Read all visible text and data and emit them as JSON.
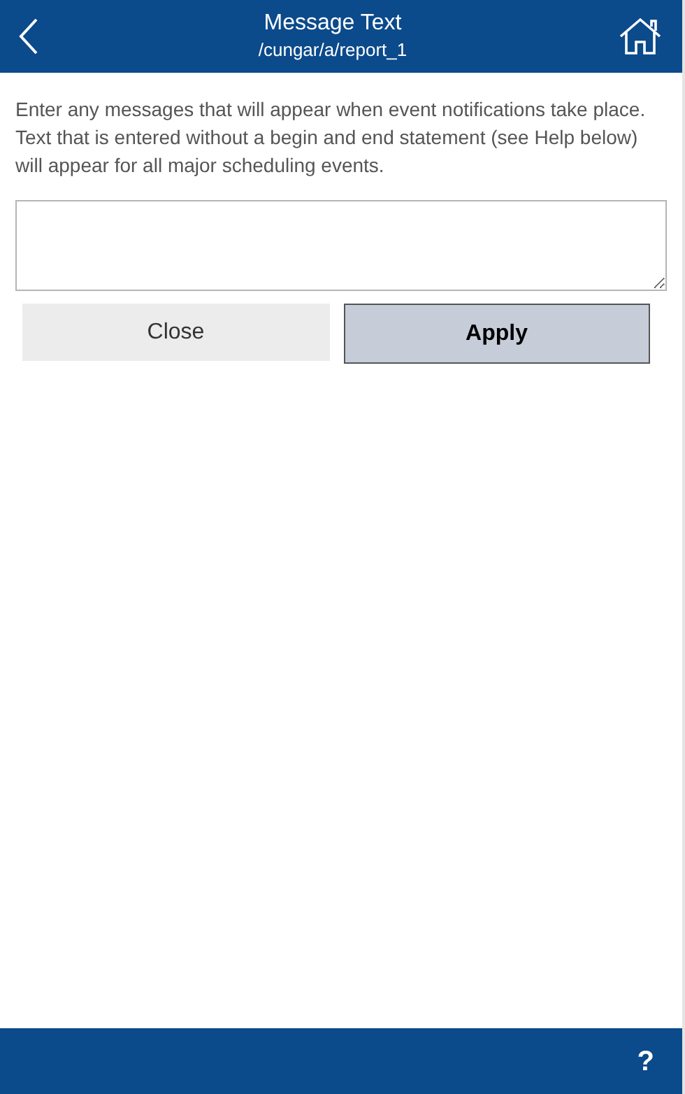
{
  "header": {
    "title": "Message Text",
    "subtitle": "/cungar/a/report_1"
  },
  "instructions": "Enter any messages that will appear when event notifications take place. Text that is entered without a begin and end statement (see Help below) will appear for all major scheduling events.",
  "buttons": [
    {
      "label": "Close",
      "kind": "secondary"
    },
    {
      "label": "Apply",
      "kind": "primary"
    }
  ],
  "footer": {
    "help": "?"
  }
}
